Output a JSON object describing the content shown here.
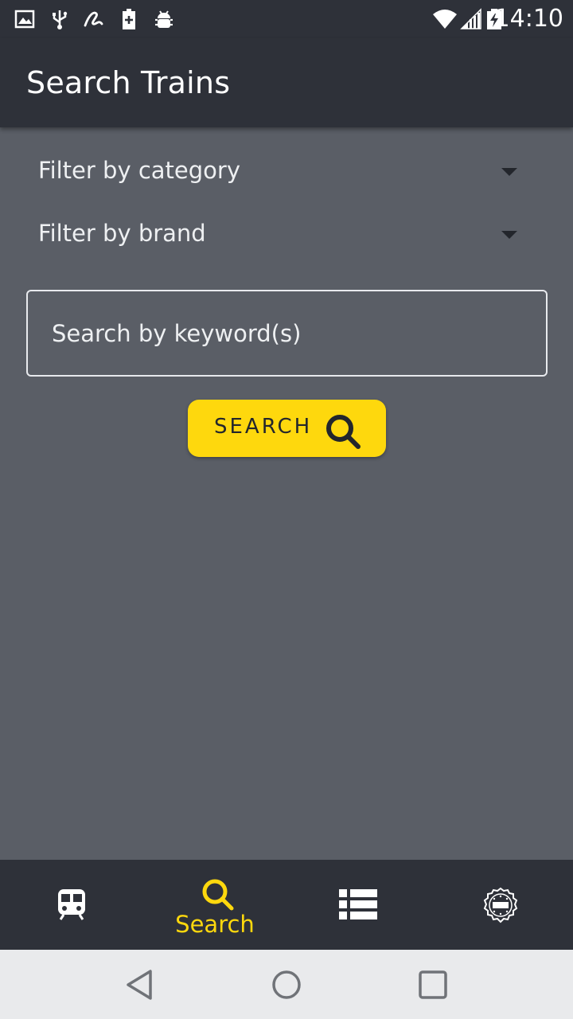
{
  "status_bar": {
    "time": "14:10",
    "icons": [
      "image-icon",
      "usb-icon",
      "signature-icon",
      "battery-plus-icon",
      "android-debug-icon",
      "wifi-icon",
      "cell-signal-icon",
      "battery-charging-icon"
    ]
  },
  "app_bar": {
    "title": "Search Trains"
  },
  "filters": {
    "category_label": "Filter by category",
    "brand_label": "Filter by brand"
  },
  "search": {
    "keyword_placeholder": "Search by keyword(s)",
    "keyword_value": "",
    "button_label": "SEARCH"
  },
  "bottom_nav": {
    "items": [
      {
        "id": "trains",
        "icon": "train-icon",
        "label": "",
        "active": false
      },
      {
        "id": "search",
        "icon": "search-icon",
        "label": "Search",
        "active": true
      },
      {
        "id": "list",
        "icon": "list-icon",
        "label": "",
        "active": false
      },
      {
        "id": "brand",
        "icon": "brand-badge-icon",
        "label": "",
        "active": false
      }
    ]
  },
  "colors": {
    "accent": "#fed80d",
    "bar_background": "#2e3139",
    "content_background": "#5a5e66",
    "system_nav_background": "#e9eaec"
  }
}
